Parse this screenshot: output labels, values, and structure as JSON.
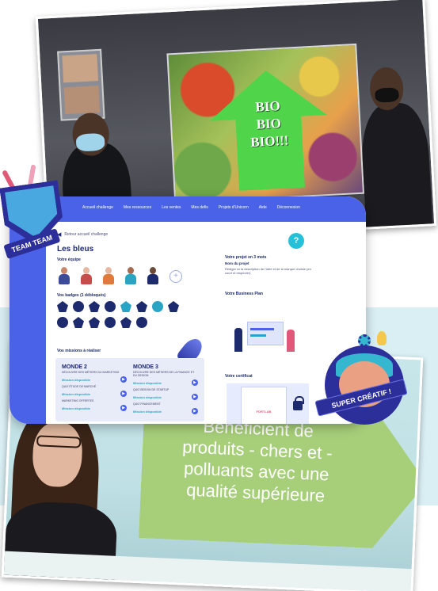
{
  "slide_top": {
    "lines": [
      "BIO",
      "BIO",
      "BIO!!!"
    ]
  },
  "app": {
    "nav": {
      "items": [
        "Accueil challenge",
        "Mes ressources",
        "Les ventes",
        "Mes defis",
        "Projets d'Unicorn",
        "Aide",
        "Déconnexion"
      ]
    },
    "back_link": "Retour accueil challenge",
    "help_label": "?",
    "team_name": "Les bleus",
    "team_section": "Votre équipe",
    "badges_section": "Vos badges (1 débloqués)",
    "missions_section": "Vos missions à réaliser",
    "project_section": "Votre projet en 3 mots",
    "project_name": "Nom du projet",
    "project_desc": "Rédiger ici la description de l'idée et de la marque choisie (en court et respecter)",
    "business_plan_section": "Votre Business Plan",
    "certificate_section": "Votre certificat",
    "certificate_logo": "FORTLAB",
    "missions": [
      {
        "title": "MONDE 2",
        "subtitle": "DÉCOUVRE DES MÉTIERS DU MARKETING",
        "rows": [
          {
            "label": "",
            "status": "Mission disponible"
          },
          {
            "label": "QUIZ ÉTUDE DE MARCHÉ",
            "status": "Mission disponible"
          },
          {
            "label": "MARKETING OFFERTES",
            "status": "Mission disponible"
          }
        ]
      },
      {
        "title": "MONDE 3",
        "subtitle": "DÉCOUVRE DES MÉTIERS DE LA FINANCE ET DU DESIGN",
        "rows": [
          {
            "label": "",
            "status": "Mission disponible"
          },
          {
            "label": "QUIZ BESOIN DE STARTUP",
            "status": "Mission disponible"
          },
          {
            "label": "QUIZ FINANCEMENT",
            "status": "Mission disponible"
          }
        ]
      }
    ]
  },
  "slide_bottom": {
    "lines": [
      "Bénéficient de",
      "produits - chers et -",
      "polluants avec une",
      "qualité supérieure"
    ]
  },
  "stickers": {
    "team_label": "TEAM TEAM",
    "creatif_label": "SUPER CRÉATIF !"
  },
  "colors": {
    "brand_blue": "#4a62e8",
    "navy": "#1d2a6e",
    "teal": "#2aa4c4",
    "green_slide": "#a7cf7a"
  }
}
